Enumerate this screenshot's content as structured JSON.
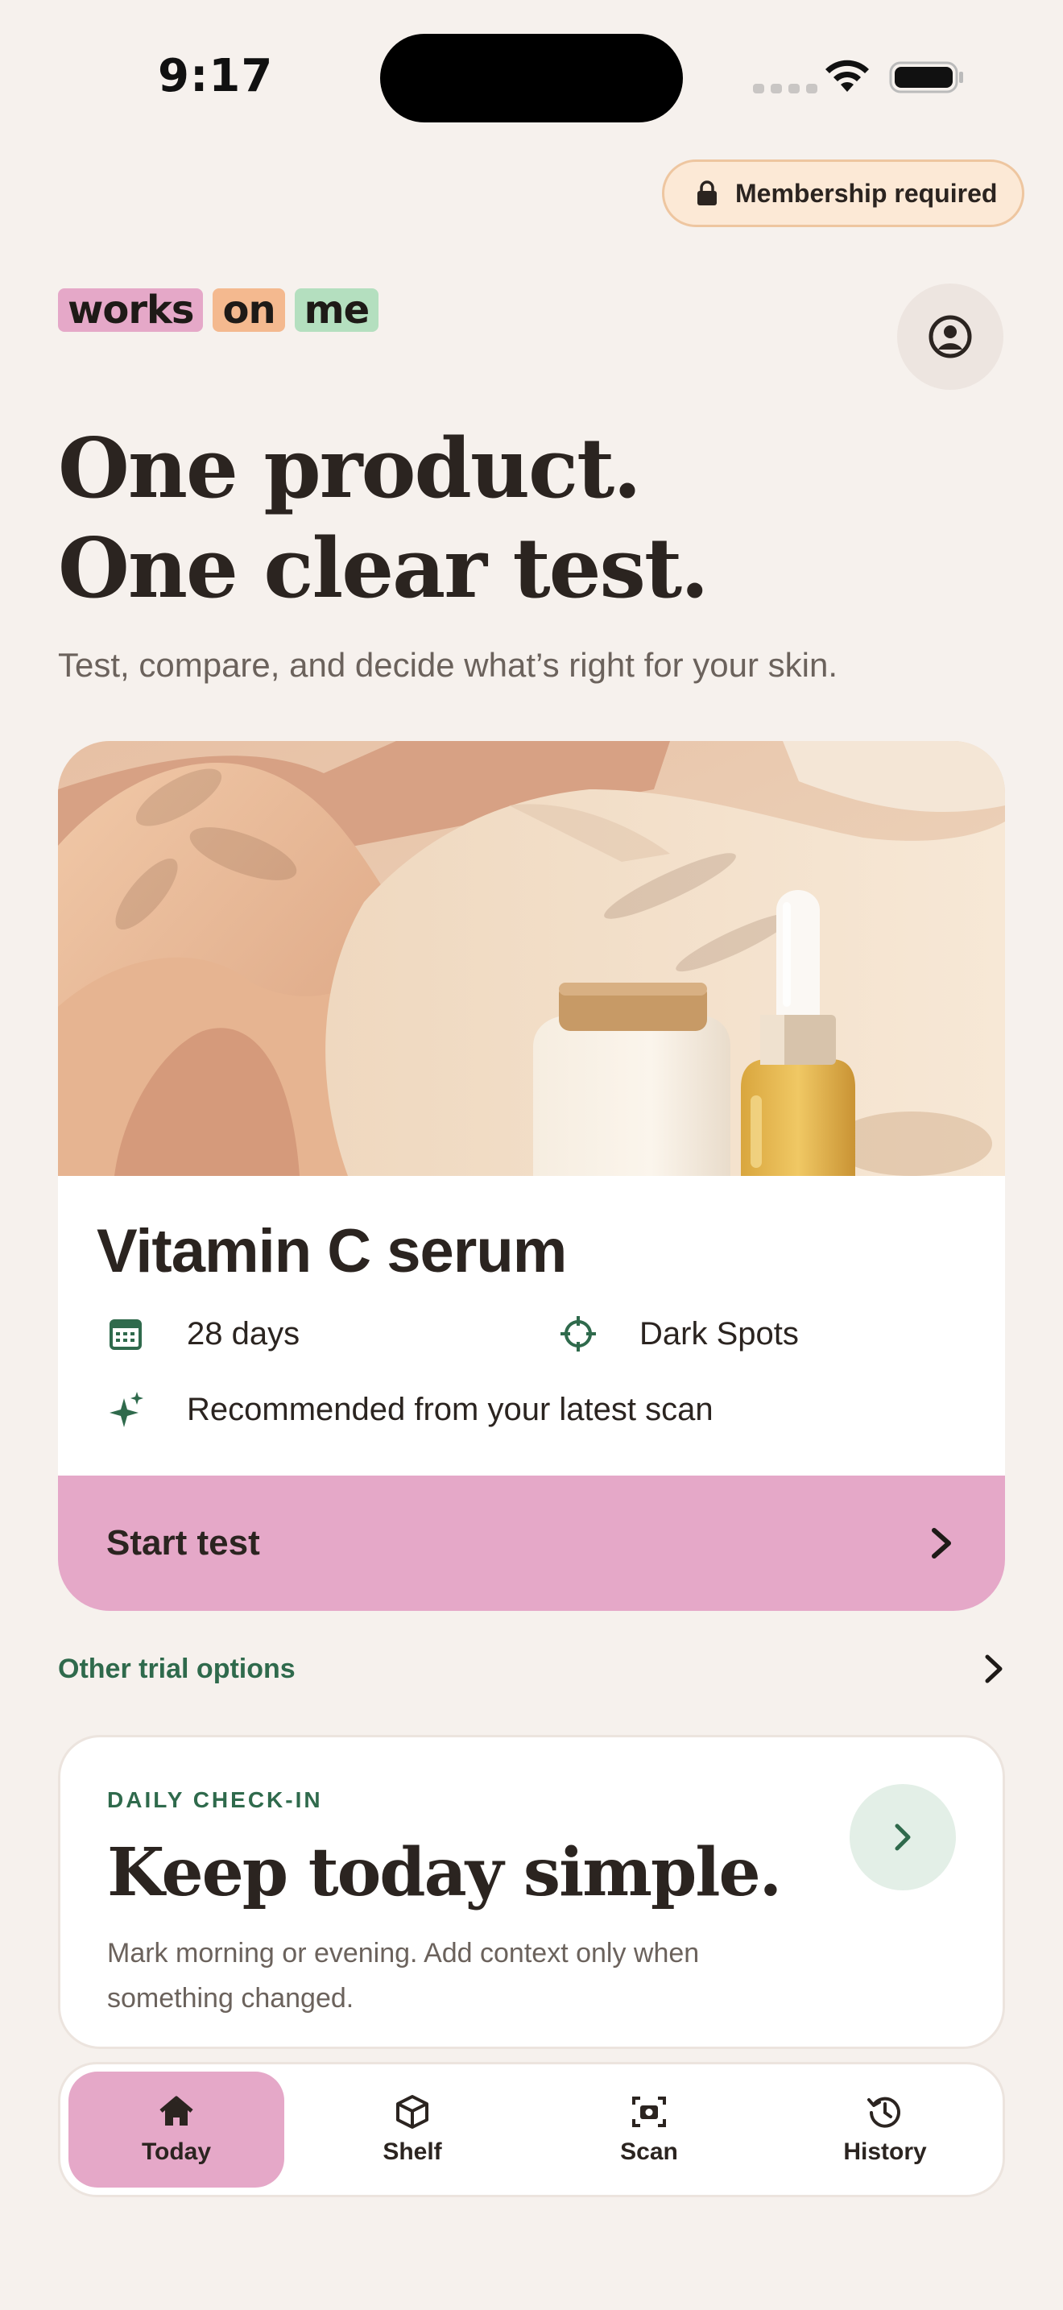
{
  "status_bar": {
    "time": "9:17"
  },
  "membership": {
    "label": "Membership required",
    "icon": "lock-icon"
  },
  "logo": {
    "words": [
      "works",
      "on",
      "me"
    ],
    "colors": [
      "#e5a8c8",
      "#f4b98f",
      "#b4dfbf"
    ]
  },
  "hero": {
    "title_line1": "One product.",
    "title_line2": "One clear test.",
    "subtitle": "Test, compare, and decide what’s right for your skin."
  },
  "product": {
    "name": "Vitamin C serum",
    "duration": "28 days",
    "target": "Dark Spots",
    "recommendation": "Recommended from your latest scan",
    "cta": "Start test"
  },
  "other_trials": {
    "label": "Other trial options"
  },
  "checkin": {
    "eyebrow": "DAILY CHECK-IN",
    "title": "Keep today simple.",
    "body": "Mark morning or evening. Add context only when something changed."
  },
  "tabs": [
    {
      "label": "Today",
      "icon": "home-icon",
      "active": true
    },
    {
      "label": "Shelf",
      "icon": "box-icon",
      "active": false
    },
    {
      "label": "Scan",
      "icon": "camera-scan-icon",
      "active": false
    },
    {
      "label": "History",
      "icon": "history-icon",
      "active": false
    }
  ],
  "colors": {
    "background": "#f6f1ed",
    "accent_pink": "#e5a8c8",
    "accent_green": "#2f6a4c",
    "membership_bg": "#fce9d6"
  }
}
